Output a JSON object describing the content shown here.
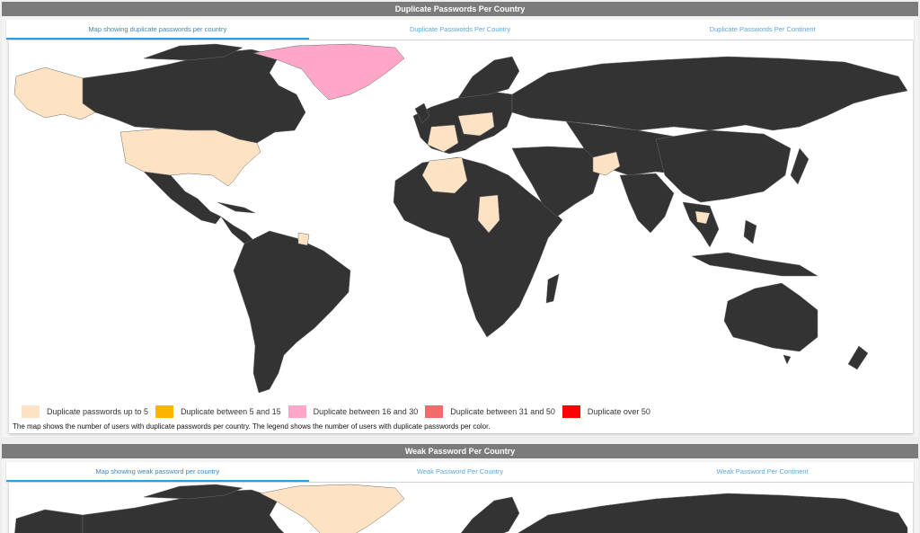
{
  "duplicate_panel": {
    "title": "Duplicate Passwords Per Country",
    "tabs": [
      {
        "label": "Map showing duplicate passwords per country",
        "active": true
      },
      {
        "label": "Duplicate Passwords Per Country",
        "active": false
      },
      {
        "label": "Duplicate Passwords Per Continent",
        "active": false
      }
    ],
    "legend": [
      {
        "label": "Duplicate passwords up to 5",
        "color": "#fde3c3"
      },
      {
        "label": "Duplicate between 5 and 15",
        "color": "#ffb400"
      },
      {
        "label": "Duplicate between 16 and 30",
        "color": "#ffa6c9"
      },
      {
        "label": "Duplicate between 31 and 50",
        "color": "#f26b6b"
      },
      {
        "label": "Duplicate over 50",
        "color": "#ff0000"
      }
    ],
    "caption": "The map shows the number of users with duplicate passwords per country. The legend shows the number of users with duplicate passwords per color."
  },
  "weak_panel": {
    "title": "Weak Password Per Country",
    "tabs": [
      {
        "label": "Map showing weak password per country",
        "active": true
      },
      {
        "label": "Weak Password Per Country",
        "active": false
      },
      {
        "label": "Weak Password Per Continent",
        "active": false
      }
    ]
  },
  "colors": {
    "land": "#333333",
    "border": "#6a6a6a",
    "highlight_low": "#fde3c3",
    "highlight_mid": "#ffa6c9"
  }
}
